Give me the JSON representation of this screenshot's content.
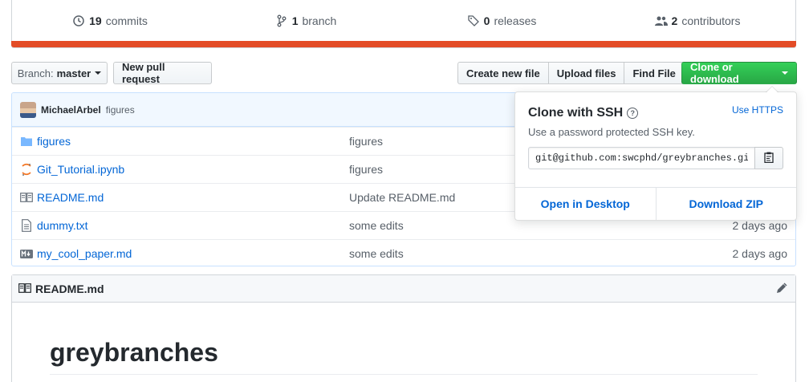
{
  "summary": {
    "commits": {
      "count": "19",
      "label": "commits",
      "icon": "history-icon"
    },
    "branches": {
      "count": "1",
      "label": "branch",
      "icon": "git-branch-icon"
    },
    "releases": {
      "count": "0",
      "label": "releases",
      "icon": "tag-icon"
    },
    "contributors": {
      "count": "2",
      "label": "contributors",
      "icon": "people-icon"
    },
    "language_color": "#e34c26"
  },
  "toolbar": {
    "branch_prefix": "Branch:",
    "branch_name": "master",
    "new_pull_request": "New pull request",
    "create_new_file": "Create new file",
    "upload_files": "Upload files",
    "find_file": "Find File",
    "clone_or_download": "Clone or download"
  },
  "commit_tease": {
    "author": "MichaelArbel",
    "message": "figures"
  },
  "files": [
    {
      "name": "figures",
      "icon": "folder-icon",
      "message": "figures",
      "age": ""
    },
    {
      "name": "Git_Tutorial.ipynb",
      "icon": "jupyter-icon",
      "message": "figures",
      "age": ""
    },
    {
      "name": "README.md",
      "icon": "book-icon",
      "message": "Update README.md",
      "age": ""
    },
    {
      "name": "dummy.txt",
      "icon": "file-text-icon",
      "message": "some edits",
      "age": "2 days ago"
    },
    {
      "name": "my_cool_paper.md",
      "icon": "markdown-icon",
      "message": "some edits",
      "age": "2 days ago"
    }
  ],
  "readme": {
    "header": "README.md",
    "title": "greybranches"
  },
  "clone_popover": {
    "title": "Clone with SSH",
    "use_https": "Use HTTPS",
    "description": "Use a password protected SSH key.",
    "url": "git@github.com:swcphd/greybranches.git",
    "open_in_desktop": "Open in Desktop",
    "download_zip": "Download ZIP"
  },
  "colors": {
    "link": "#0366d6",
    "primary_button": "#28a745",
    "muted_text": "#586069"
  }
}
